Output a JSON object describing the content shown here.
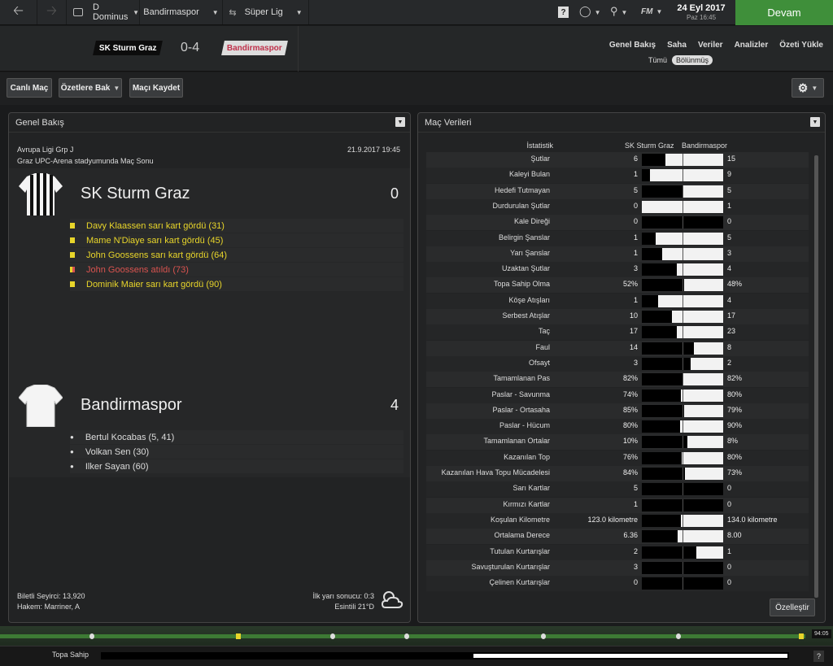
{
  "topbar": {
    "profile": "D Dominus",
    "club": "Bandirmaspor",
    "competition": "Süper Lig",
    "help": "?",
    "fm": "FM",
    "date": "24 Eyl 2017",
    "day": "Paz 16:45",
    "continue": "Devam"
  },
  "header": {
    "home": "SK Sturm Graz",
    "away": "Bandirmaspor",
    "score": "0-4",
    "tabs": [
      "Genel Bakış",
      "Saha",
      "Veriler",
      "Analizler",
      "Özeti Yükle"
    ],
    "subtabs": [
      "Tümü",
      "Bölünmüş"
    ]
  },
  "toolbar": {
    "live": "Canlı Maç",
    "highlights": "Özetlere Bak",
    "save": "Maçı Kaydet"
  },
  "overview": {
    "title": "Genel Bakış",
    "competition": "Avrupa Ligi Grp J",
    "datetime": "21.9.2017 19:45",
    "venue": "Graz UPC-Arena stadyumunda Maç Sonu",
    "home": {
      "name": "SK Sturm Graz",
      "score": "0",
      "events": [
        {
          "text": "Davy Klaassen sarı kart gördü (31)",
          "type": "yellow"
        },
        {
          "text": "Mame N'Diaye sarı kart gördü (45)",
          "type": "yellow"
        },
        {
          "text": "John Goossens sarı kart gördü (64)",
          "type": "yellow"
        },
        {
          "text": "John Goossens atıldı (73)",
          "type": "red"
        },
        {
          "text": "Dominik Maier sarı kart gördü (90)",
          "type": "yellow"
        }
      ]
    },
    "away": {
      "name": "Bandirmaspor",
      "score": "4",
      "events": [
        {
          "text": "Bertul Kocabas (5, 41)",
          "type": "goal"
        },
        {
          "text": "Volkan Sen (30)",
          "type": "goal"
        },
        {
          "text": "Ilker Sayan (60)",
          "type": "goal"
        }
      ]
    },
    "attendance": "Biletli Seyirci: 13,920",
    "referee": "Hakem: Marriner, A",
    "halftime": "İlk yarı sonucu: 0:3",
    "weather": "Esintili 21°D"
  },
  "stats": {
    "title": "Maç Verileri",
    "col_stat": "İstatistik",
    "col_home": "SK Sturm Graz",
    "col_away": "Bandirmaspor",
    "customize": "Özelleştir",
    "rows": [
      {
        "label": "Şutlar",
        "home": "6",
        "away": "15",
        "share": 0.29
      },
      {
        "label": "Kaleyi Bulan",
        "home": "1",
        "away": "9",
        "share": 0.1
      },
      {
        "label": "Hedefi Tutmayan",
        "home": "5",
        "away": "5",
        "share": 0.5
      },
      {
        "label": "Durdurulan Şutlar",
        "home": "0",
        "away": "1",
        "share": 0.0
      },
      {
        "label": "Kale Direği",
        "home": "0",
        "away": "0",
        "share": 0.5
      },
      {
        "label": "Belirgin Şanslar",
        "home": "1",
        "away": "5",
        "share": 0.17
      },
      {
        "label": "Yarı Şanslar",
        "home": "1",
        "away": "3",
        "share": 0.25
      },
      {
        "label": "Uzaktan Şutlar",
        "home": "3",
        "away": "4",
        "share": 0.43
      },
      {
        "label": "Topa Sahip Olma",
        "home": "52%",
        "away": "48%",
        "share": 0.52
      },
      {
        "label": "Köşe Atışları",
        "home": "1",
        "away": "4",
        "share": 0.2
      },
      {
        "label": "Serbest Atışlar",
        "home": "10",
        "away": "17",
        "share": 0.37
      },
      {
        "label": "Taç",
        "home": "17",
        "away": "23",
        "share": 0.43
      },
      {
        "label": "Faul",
        "home": "14",
        "away": "8",
        "share": 0.64
      },
      {
        "label": "Ofsayt",
        "home": "3",
        "away": "2",
        "share": 0.6
      },
      {
        "label": "Tamamlanan Pas",
        "home": "82%",
        "away": "82%",
        "share": 0.5
      },
      {
        "label": "Paslar - Savunma",
        "home": "74%",
        "away": "80%",
        "share": 0.48
      },
      {
        "label": "Paslar - Ortasaha",
        "home": "85%",
        "away": "79%",
        "share": 0.52
      },
      {
        "label": "Paslar - Hücum",
        "home": "80%",
        "away": "90%",
        "share": 0.47
      },
      {
        "label": "Tamamlanan Ortalar",
        "home": "10%",
        "away": "8%",
        "share": 0.56
      },
      {
        "label": "Kazanılan Top",
        "home": "76%",
        "away": "80%",
        "share": 0.49
      },
      {
        "label": "Kazanılan Hava Topu Mücadelesi",
        "home": "84%",
        "away": "73%",
        "share": 0.53
      },
      {
        "label": "Sarı Kartlar",
        "home": "5",
        "away": "0",
        "share": 1.0
      },
      {
        "label": "Kırmızı Kartlar",
        "home": "1",
        "away": "0",
        "share": 1.0
      },
      {
        "label": "Koşulan Kilometre",
        "home": "123.0 kilometre",
        "away": "134.0 kilometre",
        "share": 0.48
      },
      {
        "label": "Ortalama Derece",
        "home": "6.36",
        "away": "8.00",
        "share": 0.44
      },
      {
        "label": "Tutulan Kurtarışlar",
        "home": "2",
        "away": "1",
        "share": 0.67
      },
      {
        "label": "Savuşturulan Kurtarışlar",
        "home": "3",
        "away": "0",
        "share": 1.0
      },
      {
        "label": "Çelinen Kurtarışlar",
        "home": "0",
        "away": "0",
        "share": 0.5
      }
    ]
  },
  "timeline": {
    "clock": "94:05"
  },
  "bottom": {
    "possession": "Topa Sahip",
    "possession_home": 0.52,
    "help": "?"
  },
  "colors": {
    "accent": "#3f8f3a",
    "yellow": "#e8d52a",
    "red": "#d9534f",
    "away_badge": "#c0304a"
  }
}
